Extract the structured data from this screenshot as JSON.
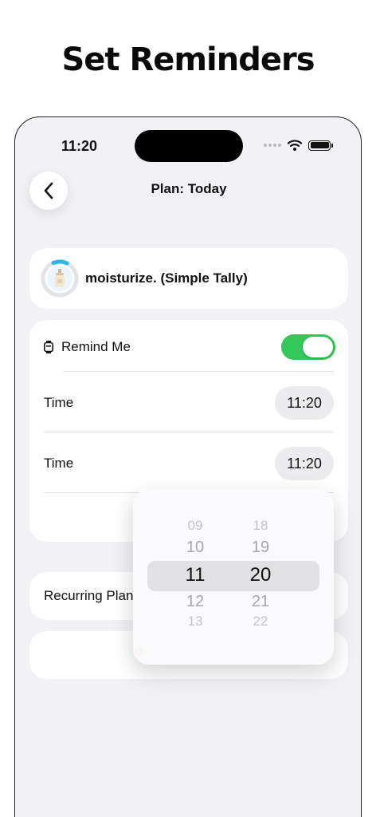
{
  "headline": "Set Reminders",
  "status_bar": {
    "time": "11:20"
  },
  "nav": {
    "title": "Plan: Today"
  },
  "plan": {
    "title": "moisturize. (Simple Tally)"
  },
  "reminder": {
    "label": "Remind Me",
    "enabled": true,
    "time_rows": [
      {
        "label": "Time",
        "value": "11:20"
      },
      {
        "label": "Time",
        "value": "11:20"
      }
    ]
  },
  "recurring": {
    "label": "Recurring Plan"
  },
  "picker": {
    "hours": [
      "09",
      "10",
      "11",
      "12",
      "13"
    ],
    "minutes": [
      "18",
      "19",
      "20",
      "21",
      "22"
    ],
    "selected_hour": "11",
    "selected_minute": "20"
  },
  "colors": {
    "accent_green": "#34c759",
    "ring_blue": "#2ab7e6",
    "destructive_red": "#ff3b30"
  },
  "icons": {
    "back": "chevron-left-icon",
    "remind": "watch-icon",
    "habit": "lotion-bottle-icon"
  }
}
